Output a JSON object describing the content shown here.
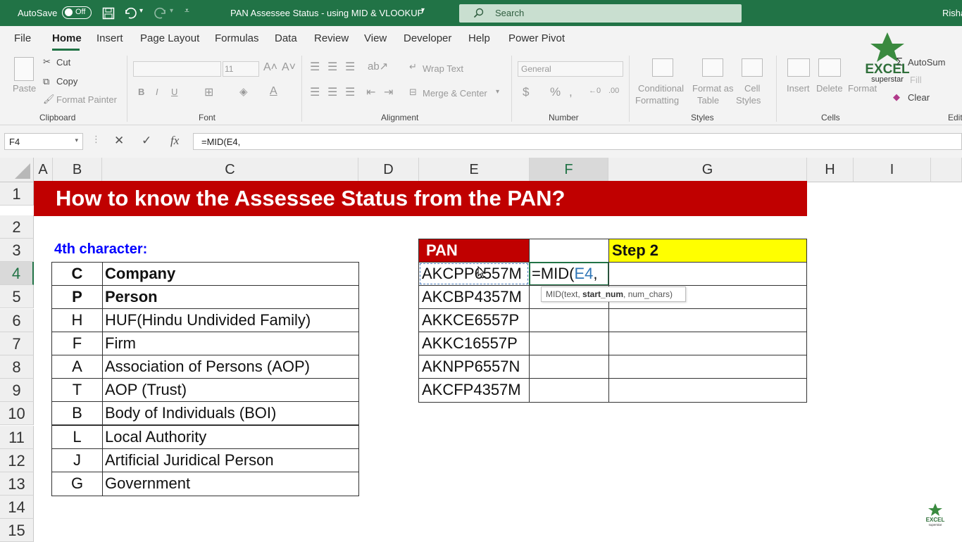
{
  "titlebar": {
    "autosave_label": "AutoSave",
    "autosave_state": "Off",
    "doc_title": "PAN Assessee Status - using MID & VLOOKUP",
    "search_placeholder": "Search",
    "user": "Risha"
  },
  "tabs": [
    "File",
    "Home",
    "Insert",
    "Page Layout",
    "Formulas",
    "Data",
    "Review",
    "View",
    "Developer",
    "Help",
    "Power Pivot"
  ],
  "ribbon": {
    "clipboard": {
      "paste": "Paste",
      "cut": "Cut",
      "copy": "Copy",
      "format_painter": "Format Painter",
      "label": "Clipboard"
    },
    "font": {
      "size": "11",
      "label": "Font"
    },
    "alignment": {
      "wrap": "Wrap Text",
      "merge": "Merge & Center",
      "label": "Alignment"
    },
    "number": {
      "format": "General",
      "label": "Number"
    },
    "styles": {
      "conditional": "Conditional",
      "formatting": "Formatting",
      "format_as": "Format as",
      "table": "Table",
      "cell": "Cell",
      "cell_styles": "Styles",
      "label": "Styles"
    },
    "cells": {
      "insert": "Insert",
      "delete": "Delete",
      "format": "Format",
      "label": "Cells"
    },
    "editing": {
      "autosum": "AutoSum",
      "fill": "Fill",
      "clear": "Clear",
      "label": "Editi"
    }
  },
  "formula_bar": {
    "name_box": "F4",
    "formula": "=MID(E4,"
  },
  "columns": [
    "A",
    "B",
    "C",
    "D",
    "E",
    "F",
    "G",
    "H",
    "I"
  ],
  "rows": [
    "1",
    "2",
    "3",
    "4",
    "5",
    "6",
    "7",
    "8",
    "9",
    "10",
    "11",
    "12",
    "13",
    "14",
    "15"
  ],
  "sheet": {
    "banner": "How to know the Assessee Status from the PAN?",
    "subhead": "4th character:",
    "status_table": [
      {
        "code": "C",
        "meaning": "Company"
      },
      {
        "code": "P",
        "meaning": "Person"
      },
      {
        "code": "H",
        "meaning": "HUF(Hindu Undivided Family)"
      },
      {
        "code": "F",
        "meaning": "Firm"
      },
      {
        "code": "A",
        "meaning": "Association of Persons (AOP)"
      },
      {
        "code": "T",
        "meaning": "AOP (Trust)"
      },
      {
        "code": "B",
        "meaning": "Body of Individuals (BOI)"
      },
      {
        "code": "L",
        "meaning": "Local Authority"
      },
      {
        "code": "J",
        "meaning": "Artificial Juridical Person"
      },
      {
        "code": "G",
        "meaning": "Government"
      }
    ],
    "pan_header": "PAN",
    "step2_header": "Step 2",
    "pans": [
      "AKCPP6557M",
      "AKCBP4357M",
      "AKKCE6557P",
      "AKKC16557P",
      "AKNPP6557N",
      "AKCFP4357M"
    ],
    "editing_formula_prefix": "=MID(",
    "editing_formula_ref": "E4",
    "editing_formula_suffix": ",",
    "tooltip_prefix": "MID(text, ",
    "tooltip_bold": "start_num",
    "tooltip_suffix": ", num_chars)"
  },
  "logo": {
    "line1": "EXCEL",
    "line2": "superstar"
  },
  "colors": {
    "excel_green": "#217346",
    "banner_red": "#c00000",
    "step2_yellow": "#ffff00",
    "subhead_blue": "#0000ff"
  }
}
